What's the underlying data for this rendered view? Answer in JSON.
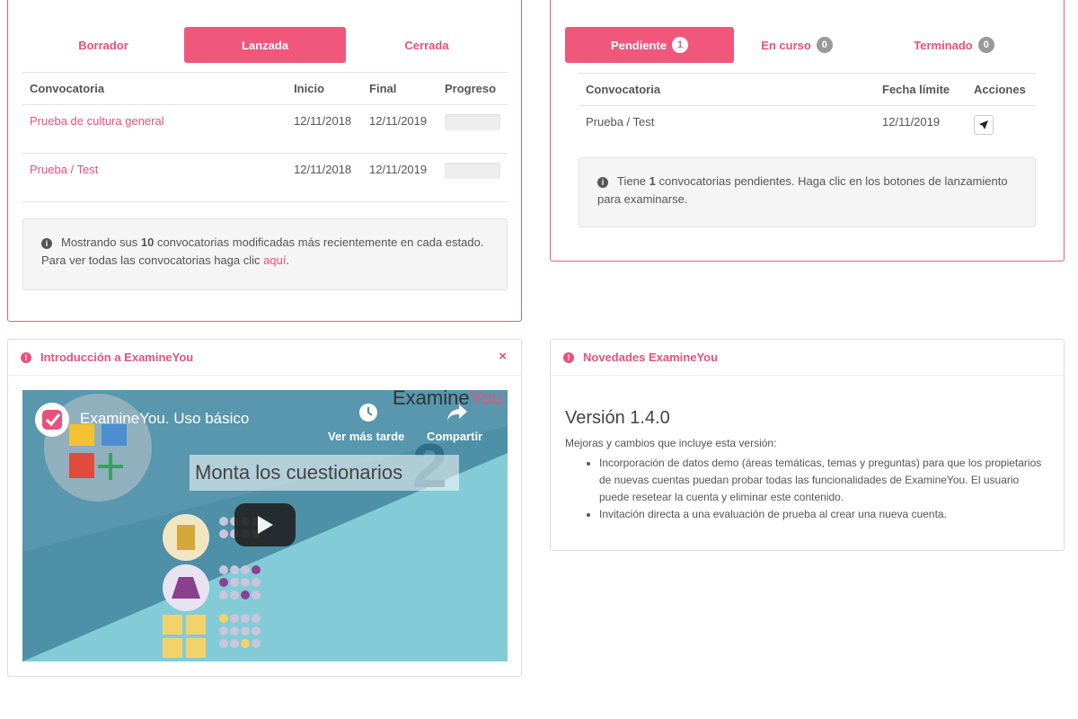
{
  "left_panel": {
    "tabs": [
      {
        "label": "Borrador",
        "active": false
      },
      {
        "label": "Lanzada",
        "active": true
      },
      {
        "label": "Cerrada",
        "active": false
      }
    ],
    "table": {
      "headers": [
        "Convocatoria",
        "Inicio",
        "Final",
        "Progreso"
      ],
      "rows": [
        {
          "name": "Prueba de cultura general",
          "start": "12/11/2018",
          "end": "12/11/2019",
          "progress": 0
        },
        {
          "name": "Prueba / Test",
          "start": "12/11/2018",
          "end": "12/11/2019",
          "progress": 0
        }
      ]
    },
    "info": {
      "pre": "Mostrando sus ",
      "count": "10",
      "post": " convocatorias modificadas más recientemente en cada estado. Para ver todas las convocatorias haga clic ",
      "link": "aquí",
      "end": "."
    }
  },
  "right_panel": {
    "tabs": [
      {
        "label": "Pendiente",
        "badge": "1",
        "active": true
      },
      {
        "label": "En curso",
        "badge": "0",
        "active": false
      },
      {
        "label": "Terminado",
        "badge": "0",
        "active": false
      }
    ],
    "table": {
      "headers": [
        "Convocatoria",
        "Fecha límite",
        "Acciones"
      ],
      "rows": [
        {
          "name": "Prueba / Test",
          "deadline": "12/11/2019",
          "action_icon": "rocket-icon"
        }
      ]
    },
    "info": {
      "pre": "Tiene ",
      "count": "1",
      "post": " convocatorias pendientes. Haga clic en los botones de lanzamiento para examinarse."
    }
  },
  "intro_panel": {
    "title": "Introducción a ExamineYou",
    "close": "×",
    "video": {
      "title": "ExamineYou. Uso básico",
      "watch_later": "Ver más tarde",
      "share": "Compartir",
      "brand_a": "Examine",
      "brand_b": "You",
      "headline": "Monta los cuestionarios",
      "number": "2"
    }
  },
  "news_panel": {
    "title": "Novedades ExamineYou",
    "version": "Versión 1.4.0",
    "subtitle": "Mejoras y cambios que incluye esta versión:",
    "items": [
      "Incorporación de datos demo (áreas temáticas, temas y preguntas) para que los propietarios de nuevas cuentas puedan probar todas las funcionalidades de ExamineYou. El usuario puede resetear la cuenta y eliminar este contenido.",
      "Invitación directa a una evaluación de prueba al crear una nueva cuenta."
    ]
  },
  "colors": {
    "accent": "#f0577a",
    "text": "#555555"
  }
}
